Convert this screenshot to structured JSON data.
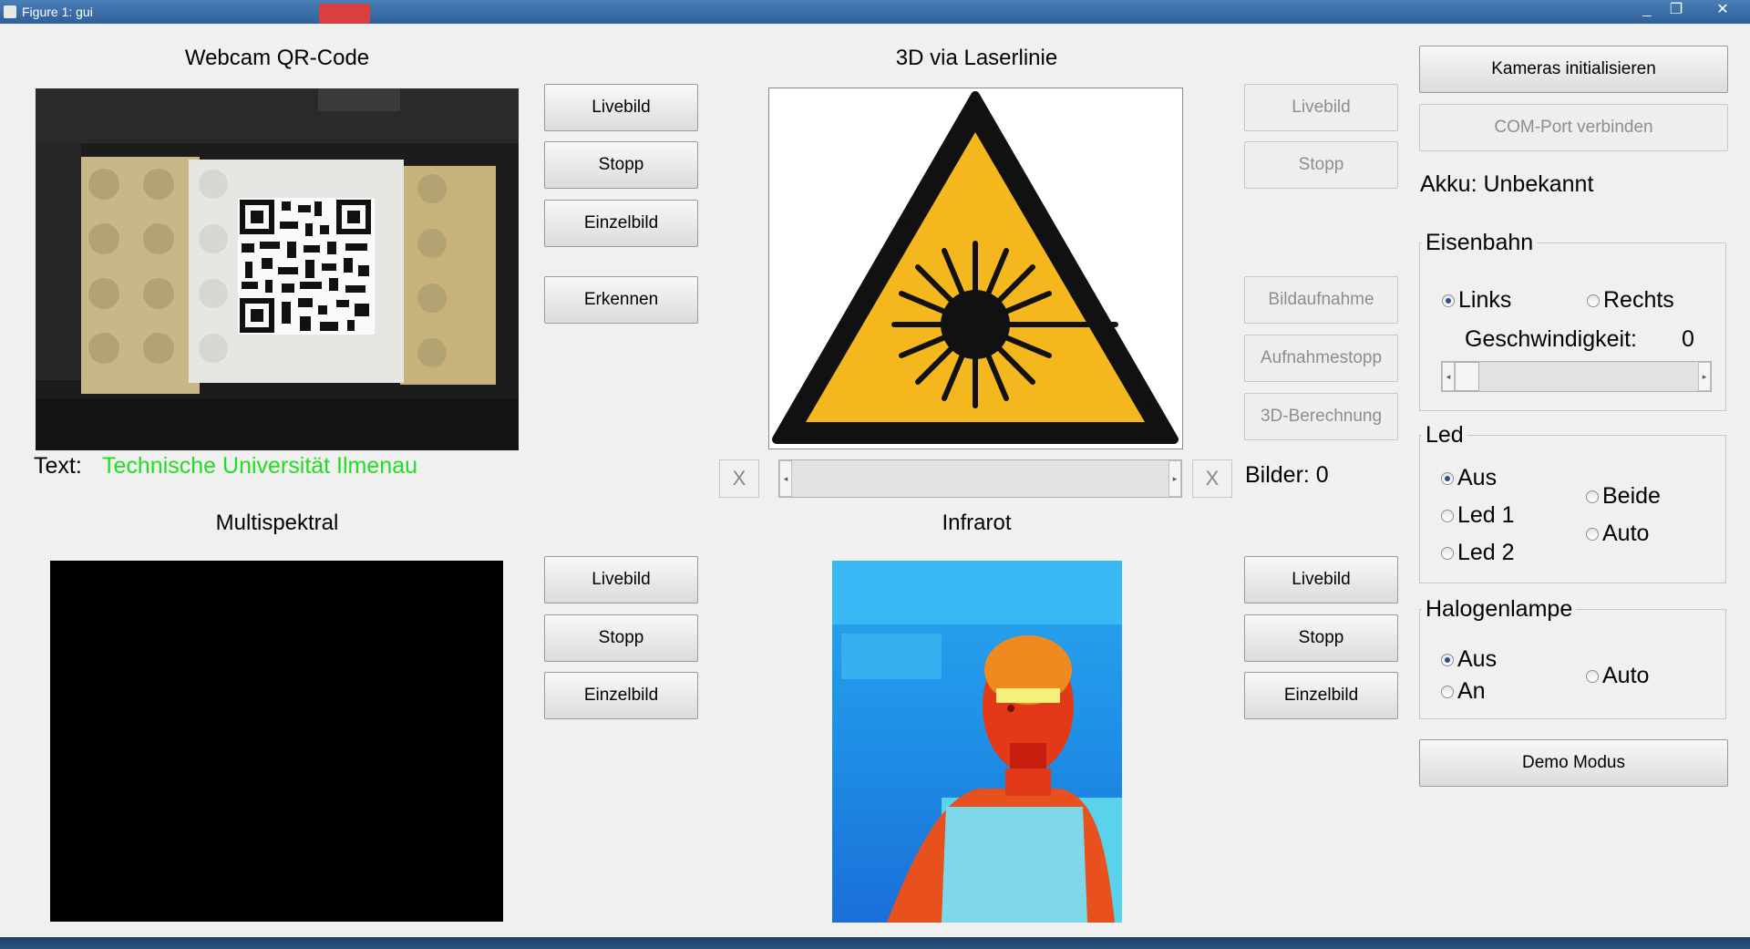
{
  "window": {
    "title": "Figure 1: gui"
  },
  "titlebar_buttons": [
    "_",
    "❐",
    "✕"
  ],
  "webcam": {
    "heading": "Webcam QR-Code",
    "text_label": "Text:",
    "text_value": "Technische Universität Ilmenau",
    "text_value_color": "#22dd22",
    "buttons": {
      "live": "Livebild",
      "stop": "Stopp",
      "single": "Einzelbild",
      "detect": "Erkennen"
    }
  },
  "laser": {
    "heading": "3D via Laserlinie",
    "buttons": {
      "live": "Livebild",
      "stop": "Stopp",
      "record": "Bildaufnahme",
      "record_stop": "Aufnahmestopp",
      "compute": "3D-Berechnung"
    },
    "x_left": "X",
    "x_right": "X",
    "images_count": "Bilder: 0"
  },
  "multispectral": {
    "heading": "Multispektral",
    "buttons": {
      "live": "Livebild",
      "stop": "Stopp",
      "single": "Einzelbild"
    }
  },
  "infrared": {
    "heading": "Infrarot",
    "buttons": {
      "live": "Livebild",
      "stop": "Stopp",
      "single": "Einzelbild"
    }
  },
  "right": {
    "init_cameras": "Kameras initialisieren",
    "com_port": "COM-Port verbinden",
    "battery": "Akku: Unbekannt",
    "railway": {
      "title": "Eisenbahn",
      "left": "Links",
      "right": "Rechts",
      "speed_label": "Geschwindigkeit:",
      "speed_value": "0",
      "speed_level": 0
    },
    "led": {
      "title": "Led",
      "off": "Aus",
      "led1": "Led 1",
      "led2": "Led 2",
      "both": "Beide",
      "auto": "Auto"
    },
    "halogen": {
      "title": "Halogenlampe",
      "off": "Aus",
      "on": "An",
      "auto": "Auto"
    },
    "demo": "Demo Modus"
  },
  "colors": {
    "titlebar": "#3a6ea5",
    "background": "#f0f0f0",
    "laser_warning": "#f4b81e"
  }
}
